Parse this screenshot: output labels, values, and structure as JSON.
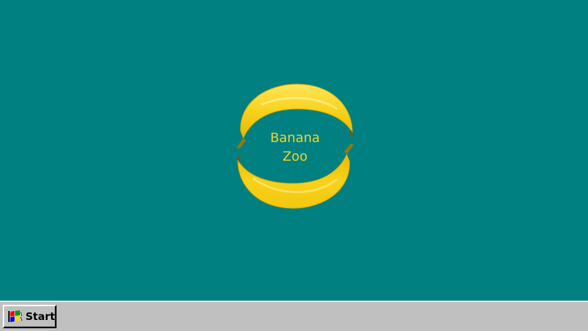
{
  "desktop": {
    "background_color": "#008080",
    "logo": {
      "line1": "Banana",
      "line2": "Zoo",
      "banana_color": "#f7d21c",
      "text_color": "#f2d22e"
    }
  },
  "taskbar": {
    "background_color": "#c0c0c0",
    "start_button": {
      "label": "Start",
      "icon": "windows-flag-icon"
    }
  }
}
